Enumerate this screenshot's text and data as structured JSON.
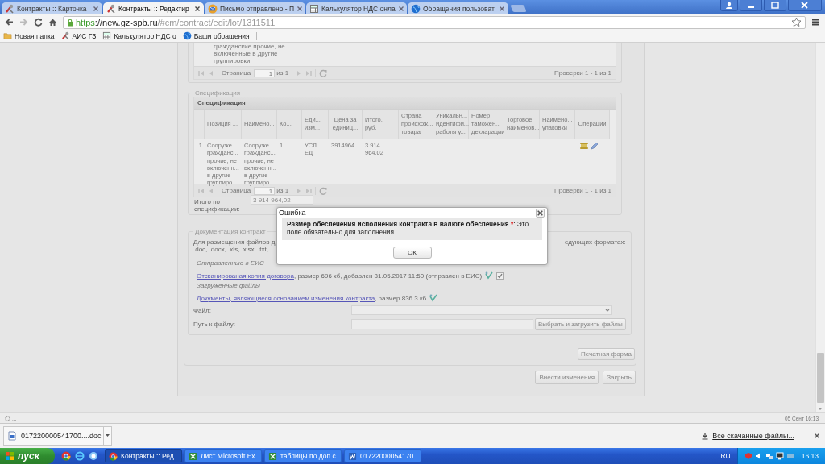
{
  "browser_tabs": [
    {
      "title": "Контракты :: Карточка",
      "selected": false
    },
    {
      "title": "Контракты :: Редактир",
      "selected": true
    },
    {
      "title": "Письмо отправлено - П",
      "selected": false
    },
    {
      "title": "Калькулятор НДС онла",
      "selected": false
    },
    {
      "title": "Обращения пользоват",
      "selected": false
    }
  ],
  "address_bar": {
    "scheme": "https",
    "host": "://new.gz-spb.ru",
    "path": "/#cm/contract/edit/lot/1311511"
  },
  "bookmarks": [
    {
      "label": "Новая папка"
    },
    {
      "label": "АИС ГЗ"
    },
    {
      "label": "Калькулятор НДС о"
    },
    {
      "label": "Ваши обращения"
    }
  ],
  "checks_panel": {
    "cell_text": "гражданские прочие, не включенные в другие группировки",
    "pager": {
      "page_label": "Страница",
      "page": "1",
      "of": "из 1",
      "summary": "Проверки 1 - 1 из 1"
    }
  },
  "specification": {
    "legend": "Спецификация",
    "grid_title": "Спецификация",
    "columns": [
      {
        "label": "Позиция ...",
        "kind": "text"
      },
      {
        "label": "Наимено...",
        "kind": "text"
      },
      {
        "label": "Ко...",
        "kind": "text"
      },
      {
        "label": "Еди... изм...",
        "kind": "text"
      },
      {
        "label": "Цена за единиц...",
        "kind": "center"
      },
      {
        "label": "Итого, руб.",
        "kind": "number"
      },
      {
        "label": "Страна происхож... товара",
        "kind": "text"
      },
      {
        "label": "Уникальн... идентифи... работы у...",
        "kind": "text"
      },
      {
        "label": "Номер таможен... декларации",
        "kind": "text"
      },
      {
        "label": "Торговое наименов...",
        "kind": "text"
      },
      {
        "label": "Наимено... упаковки",
        "kind": "text"
      },
      {
        "label": "Операции",
        "kind": "actions"
      }
    ],
    "rows": [
      {
        "number": "1",
        "cells": [
          "Сооруже... гражданс... прочие, не включенн... в другие группиро...",
          "Сооруже... гражданс... прочие, не включенн... в другие группиро...",
          "1",
          "УСЛ ЕД",
          "3914964....",
          "3 914 964,02"
        ]
      }
    ],
    "pager": {
      "page_label": "Страница",
      "page": "1",
      "of": "из 1",
      "summary": "Проверки 1 - 1 из 1"
    },
    "total_label": "Итого по спецификации:",
    "total_value": "3 914 964,02"
  },
  "documents": {
    "legend": "Документация контракт",
    "info_left": "Для размещения файлов д",
    "info_right": "едующих форматах:",
    "info_line2": ".doc, .docx, .xls, .xlsx, .txt,",
    "groups": [
      {
        "title": "Отправленные в ЕИС",
        "files": [
          {
            "link": "Отсканированая копия договора",
            "details": ", размер 696 кб, добавлен 31.05.2017 11:50 (отправлен в ЕИС)",
            "sent": true
          }
        ]
      },
      {
        "title": "Загруженные файлы",
        "files": [
          {
            "link": "Документы, являющиеся основанием изменения контракта",
            "details": ", размер 836.3 кб",
            "sent": false
          }
        ]
      }
    ],
    "file_label": "Файл:",
    "path_label": "Путь к файлу:",
    "upload_button": "Выбрать и загрузить файлы"
  },
  "print_button": "Печатная форма",
  "actions": [
    "Внести изменения",
    "Закрыть"
  ],
  "dialog": {
    "title": "Ошибка",
    "field": "Размер обеспечения исполнения контракта в валюте обеспечения",
    "required_mark": "*",
    "message": ": Это поле обязательно для заполнения",
    "button": "ОК"
  },
  "status_bar": {
    "left": "...",
    "right": "05 Сент 16:13"
  },
  "downloads": {
    "file": "017220000541700....doc",
    "all": "Все скачанные файлы..."
  },
  "taskbar": {
    "start": "пуск",
    "tasks": [
      {
        "label": "Контракты :: Ред...",
        "selected": true
      },
      {
        "label": "Лист Microsoft Ex...",
        "selected": false
      },
      {
        "label": "таблицы по доп.с...",
        "selected": false
      },
      {
        "label": "01722000054170...",
        "selected": false
      }
    ],
    "language": "RU",
    "clock": "16:13"
  }
}
